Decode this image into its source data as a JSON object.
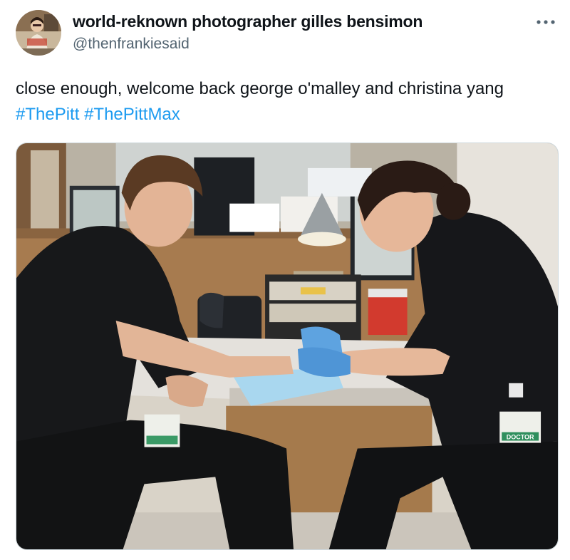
{
  "author": {
    "display_name": "world-reknown photographer gilles bensimon",
    "handle": "@thenfrankiesaid",
    "avatar_icon": "profile-avatar"
  },
  "more_icon": "more-horizontal-icon",
  "tweet": {
    "text": "close enough, welcome back george o'malley and christina yang",
    "hashtags": [
      "#ThePitt",
      "#ThePittMax"
    ]
  },
  "media": {
    "badge_text": "DOCTOR"
  },
  "colors": {
    "link": "#1d9bf0",
    "secondary_text": "#536471",
    "primary_text": "#0f1419"
  }
}
